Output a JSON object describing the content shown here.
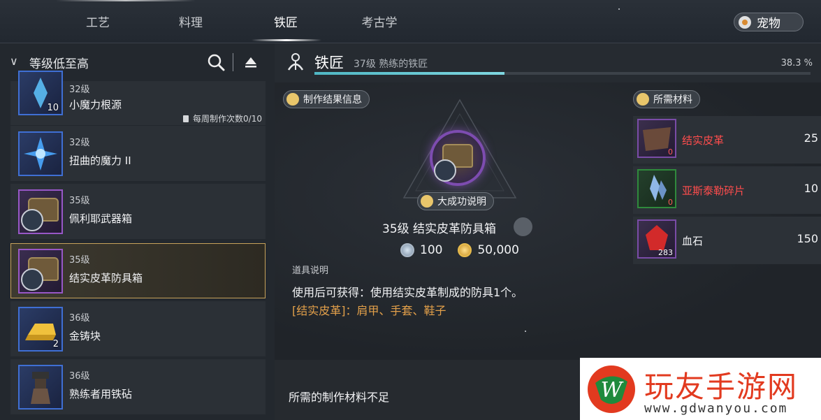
{
  "top_nav": {
    "tabs": [
      {
        "label": "工艺",
        "active": false
      },
      {
        "label": "料理",
        "active": false
      },
      {
        "label": "铁匠",
        "active": true
      },
      {
        "label": "考古学",
        "active": false
      }
    ],
    "pet_button": {
      "label": "宠物",
      "icon": "paw-icon"
    }
  },
  "sidebar": {
    "sort_label": "等级低至高",
    "items": [
      {
        "level": "32级",
        "name": "小魔力根源",
        "count": "10",
        "weekly": "每周制作次数0/10",
        "icon": "blue-crystal-icon",
        "rarity": "blue"
      },
      {
        "level": "32级",
        "name": "扭曲的魔力 II",
        "count": "",
        "icon": "blue-magic-icon",
        "rarity": "blue"
      },
      {
        "level": "35级",
        "name": "佩利耶武器箱",
        "count": "",
        "icon": "weapon-chest-icon",
        "rarity": "purple"
      },
      {
        "level": "35级",
        "name": "结实皮革防具箱",
        "count": "",
        "icon": "armor-chest-icon",
        "rarity": "purple",
        "selected": true
      },
      {
        "level": "36级",
        "name": "金铸块",
        "count": "2",
        "icon": "gold-ingot-icon",
        "rarity": "blue"
      },
      {
        "level": "36级",
        "name": "熟练者用铁砧",
        "count": "",
        "icon": "anvil-icon",
        "rarity": "blue"
      }
    ]
  },
  "header": {
    "title": "铁匠",
    "subtitle": "37级  熟练的铁匠",
    "progress_text": "38.3 %",
    "progress_fraction": 0.383
  },
  "result": {
    "section_label": "制作结果信息",
    "great_success_label": "大成功说明",
    "product_name": "35级  结实皮革防具箱",
    "cost_silver": "100",
    "cost_gold": "50,000",
    "desc_title": "道具说明",
    "desc_text": "使用后可获得：使用结实皮革制成的防具1个。",
    "desc_sub": "[结实皮革]：肩甲、手套、鞋子"
  },
  "materials": {
    "section_label": "所需材料",
    "items": [
      {
        "name": "结实皮革",
        "owned": "0",
        "required": "25",
        "sufficient": false,
        "icon": "leather-icon"
      },
      {
        "name": "亚斯泰勒碎片",
        "owned": "0",
        "required": "10",
        "sufficient": false,
        "icon": "crystal-shard-icon"
      },
      {
        "name": "血石",
        "owned": "283",
        "required": "150",
        "sufficient": true,
        "icon": "bloodstone-icon"
      }
    ]
  },
  "footer": {
    "message": "所需的制作材料不足"
  },
  "watermark": {
    "cn": "玩友手游网",
    "url": "www.gdwanyou.com"
  },
  "colors": {
    "accent_gold": "#c7a25a",
    "insufficient": "#ff4d4d",
    "xp_bar": "#4fb7c4",
    "rarity_blue": "#3f6fd4",
    "rarity_purple": "#9857c7"
  }
}
